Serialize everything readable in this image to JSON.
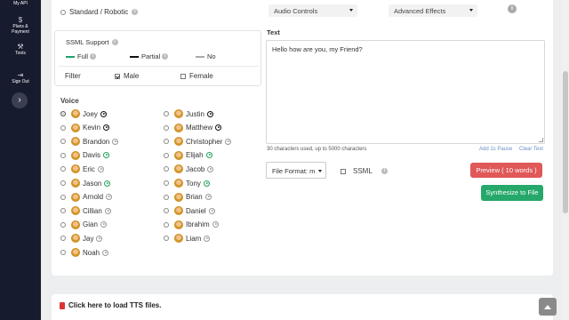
{
  "sidebar": {
    "items": [
      {
        "label": "My API",
        "icon": "api-icon"
      },
      {
        "label": "Plans & Payment",
        "icon": "dollar-icon"
      },
      {
        "label": "Tools",
        "icon": "tools-icon"
      },
      {
        "label": "Sign Out",
        "icon": "sign-out-icon"
      }
    ],
    "collapse_icon": "chevron-right-icon"
  },
  "voice_type": {
    "option": "Standard / Robotic"
  },
  "ssml_support": {
    "title": "SSML Support",
    "legend": [
      {
        "label": "Full",
        "color": "#1aa36a"
      },
      {
        "label": "Partial",
        "color": "#111111"
      },
      {
        "label": "No",
        "color": "#aaaaaa"
      }
    ]
  },
  "filter": {
    "label": "Filter",
    "male_label": "Male",
    "male_checked": true,
    "female_label": "Female",
    "female_checked": false
  },
  "voices": {
    "label": "Voice",
    "left": [
      {
        "name": "Joey",
        "ssml": "partial",
        "selected": true
      },
      {
        "name": "Kevin",
        "ssml": "partial",
        "selected": false
      },
      {
        "name": "Brandon",
        "ssml": "no",
        "selected": false
      },
      {
        "name": "Davis",
        "ssml": "full",
        "selected": false
      },
      {
        "name": "Eric",
        "ssml": "no",
        "selected": false
      },
      {
        "name": "Jason",
        "ssml": "full",
        "selected": false
      },
      {
        "name": "Arnold",
        "ssml": "no",
        "selected": false
      },
      {
        "name": "Cillian",
        "ssml": "no",
        "selected": false
      },
      {
        "name": "Gian",
        "ssml": "no",
        "selected": false
      },
      {
        "name": "Jay",
        "ssml": "no",
        "selected": false
      },
      {
        "name": "Noah",
        "ssml": "no",
        "selected": false
      }
    ],
    "right": [
      {
        "name": "Justin",
        "ssml": "partial",
        "selected": false
      },
      {
        "name": "Matthew",
        "ssml": "partial",
        "selected": false
      },
      {
        "name": "Christopher",
        "ssml": "no",
        "selected": false
      },
      {
        "name": "Elijah",
        "ssml": "full",
        "selected": false
      },
      {
        "name": "Jacob",
        "ssml": "no",
        "selected": false
      },
      {
        "name": "Tony",
        "ssml": "full",
        "selected": false
      },
      {
        "name": "Brian",
        "ssml": "no",
        "selected": false
      },
      {
        "name": "Daniel",
        "ssml": "no",
        "selected": false
      },
      {
        "name": "Ibrahim",
        "ssml": "no",
        "selected": false
      },
      {
        "name": "Liam",
        "ssml": "no",
        "selected": false
      }
    ]
  },
  "controls": {
    "audio_controls": "Audio Controls",
    "advanced_effects": "Advanced Effects"
  },
  "text": {
    "label": "Text",
    "value": "Hello how are you, my Friend?",
    "char_count": "30 characters used, up to 5000 characters",
    "add_pause": "Add 1s Pause",
    "clear_text": "Clear Text"
  },
  "output": {
    "file_format": "File Format: m",
    "ssml_label": "SSML",
    "preview_button": "Preview ( 10 words )",
    "synthesize_button": "Synthesize to File"
  },
  "footer": {
    "load_tts": "Click here to load TTS files."
  }
}
